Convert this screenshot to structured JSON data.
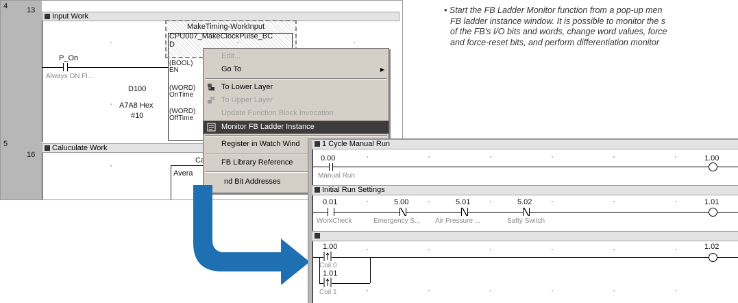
{
  "caption": {
    "bullet": "•",
    "lines": [
      "Start the FB Ladder Monitor function from a pop-up men",
      "FB ladder instance window. It is possible to monitor the s",
      "of the FB's I/O bits and words, change word values, force",
      "and force-reset bits, and perform differentiation monitor"
    ]
  },
  "ladder": {
    "rung1": {
      "left_num": "4",
      "num": "13",
      "title": "Input Work",
      "fb_name": "MakeTiming-WorkInput",
      "fb_type": "CPU007_MakeClockPulse_BC",
      "fb_d": "D",
      "contact_label": "P_On",
      "contact_comment": "Always ON Fl...",
      "in_en": "(BOOL)\nEN",
      "in_ontime": "(WORD)\nOnTime",
      "in_offtime": "(WORD)\nOffTime",
      "ontime_val": "D100",
      "offtime_val1": "A7A8 Hex",
      "offtime_val2": "#10"
    },
    "rung2": {
      "left_num": "5",
      "num": "16",
      "title": "Caluculate Work",
      "fb_name": "Ca",
      "fb_type": "Avera"
    }
  },
  "context_menu": {
    "items": [
      {
        "label": "Edit...",
        "disabled": true
      },
      {
        "label": "Go To",
        "disabled": false,
        "submenu": true
      },
      {
        "label": "To Lower Layer",
        "disabled": false,
        "icon": "lower-layer-icon"
      },
      {
        "label": "To Upper Layer",
        "disabled": true,
        "icon": "upper-layer-icon"
      },
      {
        "label": "Update Function Block Invocation",
        "disabled": true
      },
      {
        "label": "Monitor FB Ladder Instance",
        "disabled": false,
        "selected": true,
        "icon": "monitor-fb-icon"
      },
      {
        "label": "Register in Watch Wind",
        "disabled": false
      },
      {
        "label": "FB Library Reference",
        "disabled": false
      },
      {
        "label": "nd Bit Addresses",
        "disabled": false
      }
    ]
  },
  "monitor": {
    "rung1": {
      "title": "1 Cycle Manual Run",
      "contact_addr": "0.00",
      "contact_comment": "Manual Run",
      "coil_addr": "1.00"
    },
    "rung2": {
      "title": "Initial Run Settings",
      "contacts": [
        {
          "addr": "0.01",
          "comment": "WorkCheck"
        },
        {
          "addr": "5.00",
          "comment": "Emergency S..."
        },
        {
          "addr": "5.01",
          "comment": "Air Pressure ..."
        },
        {
          "addr": "5.02",
          "comment": "Safty Switch"
        }
      ],
      "coil_addr": "1.01"
    },
    "rung3": {
      "contacts": [
        {
          "addr": "1.00",
          "comment": "Coil 0"
        },
        {
          "addr": "1.01",
          "comment": "Coil 1"
        }
      ],
      "coil_addr": "1.02"
    }
  },
  "colors": {
    "arrow": "#1f6fb3",
    "menu_bg": "#d4d0c8",
    "menu_selected": "#3c3c3c",
    "header_bg": "#e3e3e3",
    "gutter": "#b7b7b7"
  }
}
